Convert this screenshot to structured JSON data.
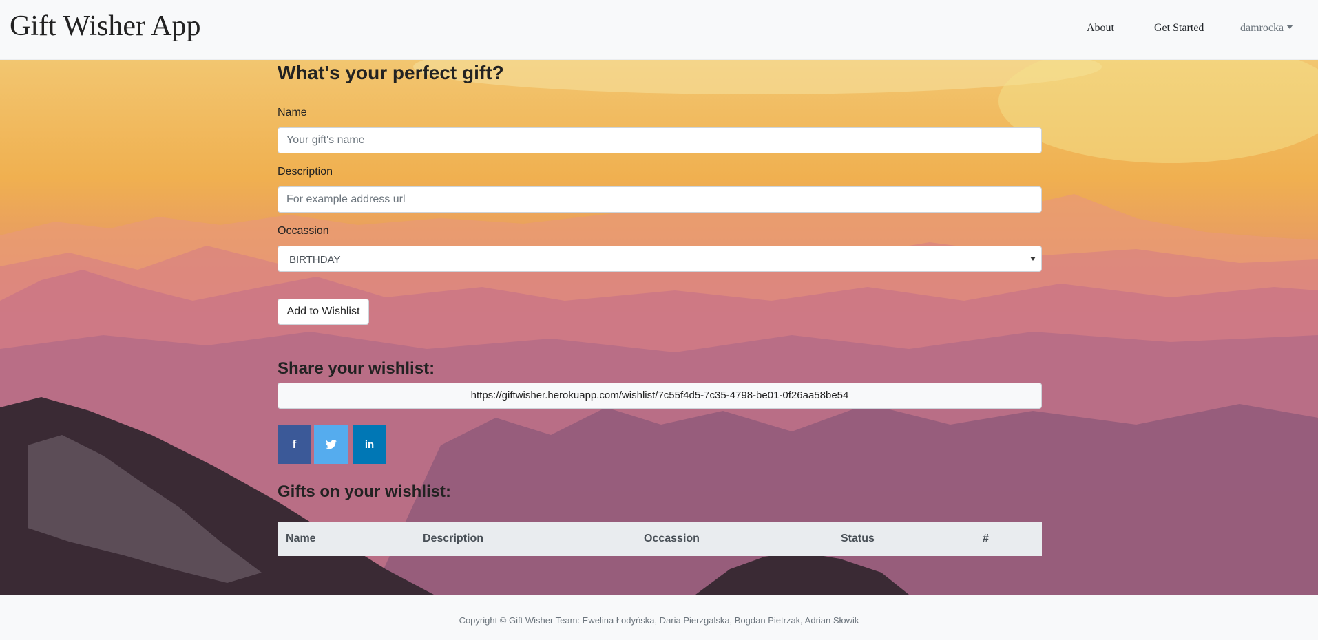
{
  "navbar": {
    "brand": "Gift Wisher App",
    "about": "About",
    "get_started": "Get Started",
    "user": "damrocka"
  },
  "form": {
    "title": "What's your perfect gift?",
    "name_label": "Name",
    "name_placeholder": "Your gift's name",
    "description_label": "Description",
    "description_placeholder": "For example address url",
    "occasion_label": "Occassion",
    "occasion_selected": "BIRTHDAY",
    "submit_label": "Add to Wishlist"
  },
  "share": {
    "title": "Share your wishlist:",
    "url": "https://giftwisher.herokuapp.com/wishlist/7c55f4d5-7c35-4798-be01-0f26aa58be54",
    "buttons": [
      {
        "icon": "facebook-icon",
        "glyph": "f",
        "color": "#3b5998"
      },
      {
        "icon": "twitter-icon",
        "glyph": "t",
        "color": "#55acee"
      },
      {
        "icon": "linkedin-icon",
        "glyph": "in",
        "color": "#0077b5"
      }
    ]
  },
  "wishlist": {
    "title": "Gifts on your wishlist:",
    "columns": [
      "Name",
      "Description",
      "Occassion",
      "Status",
      "#"
    ]
  },
  "footer": {
    "copyright": "Copyright © Gift Wisher Team: Ewelina Łodyńska, Daria Pierzgalska, Bogdan Pietrzak, Adrian Słowik"
  }
}
